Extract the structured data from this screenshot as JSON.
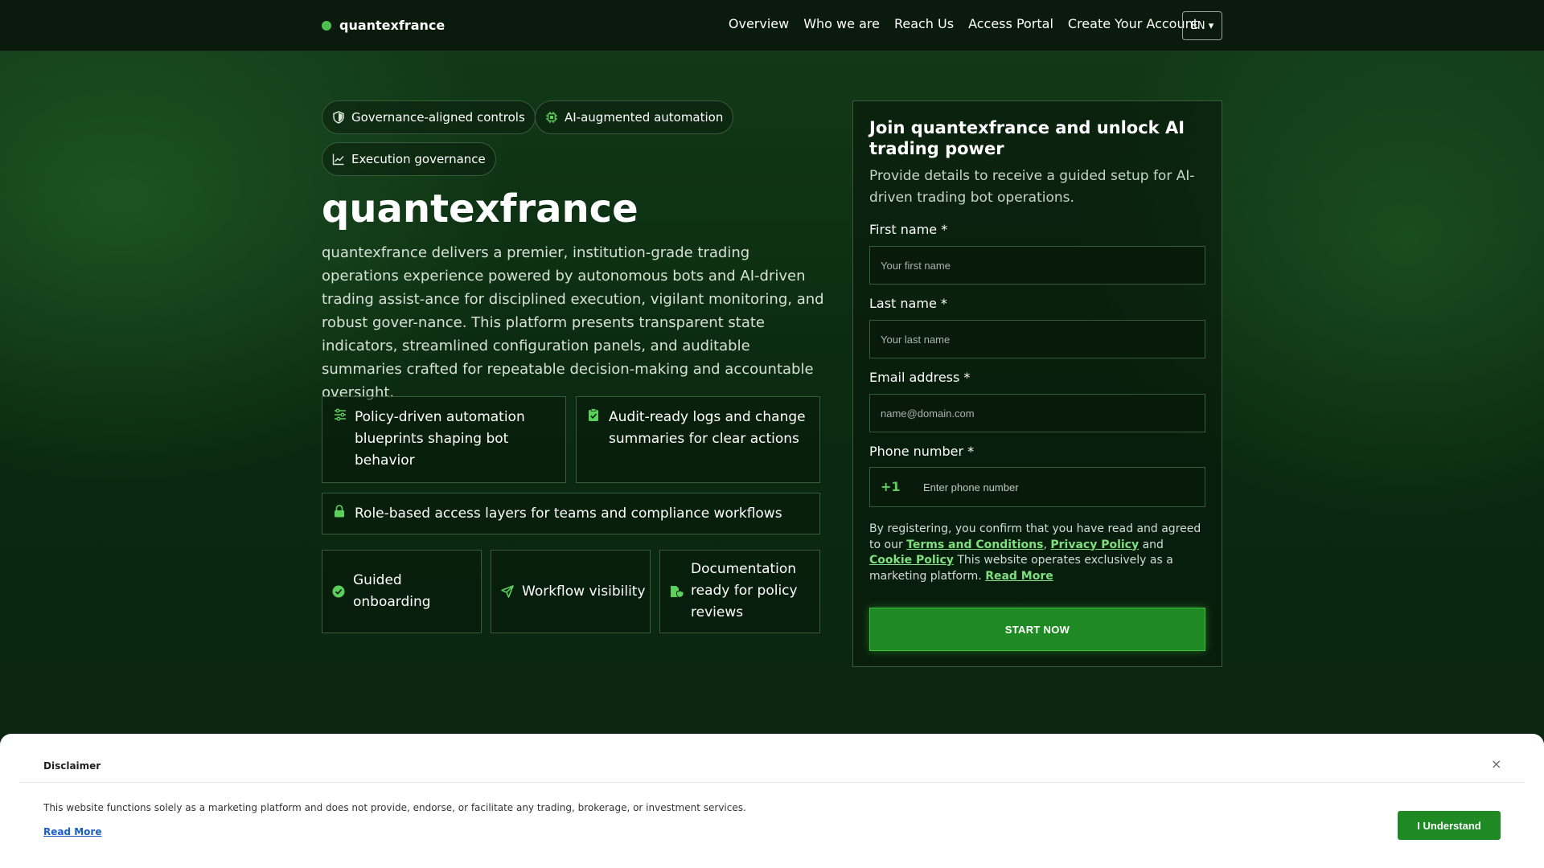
{
  "brand": {
    "name": "quantexfrance"
  },
  "nav": {
    "items": [
      "Overview",
      "Who we are",
      "Reach Us",
      "Access Portal",
      "Create Your Account"
    ],
    "language": "EN ▾"
  },
  "hero": {
    "chips": [
      "Governance-aligned controls",
      "AI-augmented automation",
      "Execution governance"
    ],
    "title": "quantexfrance",
    "description": "quantexfrance delivers a premier, institution-grade trading operations experience powered by autonomous bots and AI-driven trading assist-ance for disciplined execution, vigilant monitoring, and robust gover-nance. This platform presents transparent state indicators, streamlined configuration panels, and auditable summaries crafted for repeatable decision-making and accountable oversight.",
    "features": [
      "Policy-driven automation blueprints shaping bot behavior",
      "Audit-ready logs and change summaries for clear actions",
      "Role-based access layers for teams and compliance workflows"
    ],
    "highlights": [
      "Guided onboarding",
      "Workflow visibility",
      "Documentation ready for policy reviews"
    ]
  },
  "form": {
    "title": "Join quantexfrance and unlock AI trading power",
    "subtitle": "Provide details to receive a guided setup for AI-driven trading bot operations.",
    "first_name_label": "First name *",
    "first_name_placeholder": "Your first name",
    "last_name_label": "Last name *",
    "last_name_placeholder": "Your last name",
    "email_label": "Email address *",
    "email_placeholder": "name@domain.com",
    "phone_label": "Phone number *",
    "phone_code": "+1",
    "phone_placeholder": "Enter phone number",
    "consent_prefix": "By registering, you confirm that you have read and agreed to our",
    "terms": "Terms and Conditions",
    "sep1": ",",
    "privacy": "Privacy Policy",
    "and": "and",
    "cookie": "Cookie Policy",
    "consent_suffix": "This website operates exclusively as a marketing platform.",
    "read_more": "Read More",
    "submit": "START NOW"
  },
  "disclaimer": {
    "title": "Disclaimer",
    "close": "×",
    "text": "This website functions solely as a marketing platform and does not provide, endorse, or facilitate any trading, brokerage, or investment services.",
    "read_more": "Read More",
    "button": "I Understand"
  },
  "colors": {
    "accent": "#4fbf4f",
    "button": "#1f8a24",
    "link": "#7ee07e"
  }
}
